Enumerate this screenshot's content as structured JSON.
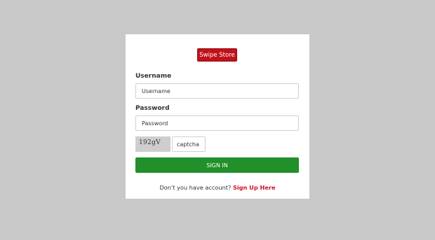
{
  "brand": {
    "label": "Swipe Store",
    "color": "#c1121a"
  },
  "form": {
    "username_label": "Username",
    "username_placeholder": "Username",
    "password_label": "Password",
    "password_placeholder": "Password",
    "captcha_text": "192gV",
    "captcha_placeholder": "captcha",
    "signin_label": "SIGN IN",
    "signin_color": "#21902a"
  },
  "footer": {
    "prompt": "Don't you have account?",
    "signup_link": "Sign Up Here",
    "link_color": "#d0112b"
  }
}
